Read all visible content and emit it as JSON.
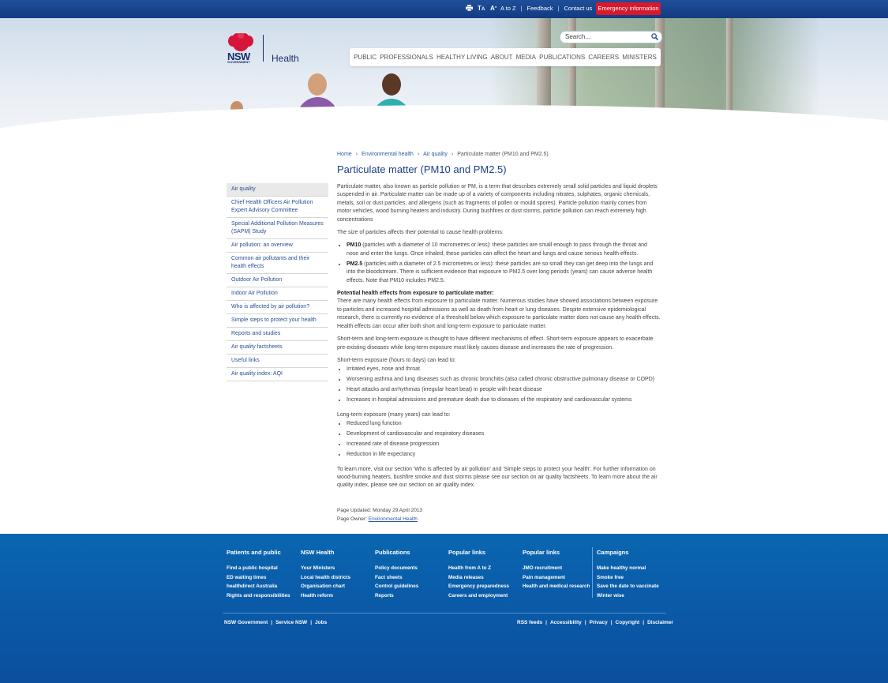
{
  "topbar": {
    "tools": [
      "print-icon",
      "text-size-icon",
      "text-resize-icon"
    ],
    "links": [
      "A to Z",
      "Feedback",
      "Contact us"
    ],
    "emergency": "Emergency information"
  },
  "logo": {
    "nsw": "NSW",
    "government": "GOVERNMENT",
    "health": "Health"
  },
  "search": {
    "placeholder": "Search..."
  },
  "nav": [
    "PUBLIC",
    "PROFESSIONALS",
    "HEALTHY LIVING",
    "ABOUT",
    "MEDIA",
    "PUBLICATIONS",
    "CAREERS",
    "MINISTERS"
  ],
  "breadcrumb": [
    "Home",
    "Environmental health",
    "Air quality",
    "Particulate matter (PM10 and PM2.5)"
  ],
  "page_title": "Particulate matter (PM10 and PM2.5)",
  "sidebar": [
    "Air quality",
    "Chief Health Officers Air Pollution Expert Advisory Committee",
    "Special Additional Pollution Measures (SAPM) Study",
    "Air pollution: an overview",
    "Common air pollutants and their health effects",
    "Outdoor Air Pollution",
    "Indoor Air Pollution",
    "Who is affected by air pollution?",
    "Simple steps to protect your health",
    "Reports and studies",
    "Air quality factsheets",
    "Useful links",
    "Air quality index: AQI"
  ],
  "content": {
    "intro": "Particulate matter, also known as particle pollution or PM, is a term that describes extremely small solid particles and liquid droplets suspended in air. Particulate matter can be made up of a variety of components including nitrates, sulphates, organic chemicals, metals, soil or dust particles, and allergens (such as fragments of pollen or mould spores). Particle pollution mainly comes from motor vehicles, wood burning heaters and industry. During bushfires or dust storms, particle pollution can reach extremely high concentrations",
    "size_intro": "The size of particles affects their potential to cause health problems:",
    "pm10_label": "PM10",
    "pm10_text": " (particles with a diameter of 10 micrometres or less): these particles are small enough to pass through the throat and nose and enter the lungs. Once inhaled, these particles can affect the heart and lungs and cause serious health effects.",
    "pm25_label": "PM2.5",
    "pm25_text": " (particles with a diameter of 2.5 micrometres or less): these particles are so small they can get deep into the lungs and into the bloodstream. There is sufficient evidence that exposure to PM2.5 over long periods (years) can cause adverse health effects. Note that PM10 includes PM2.5.",
    "effects_heading": "Potential health effects from exposure to particulate matter:",
    "effects_text": "There are many health effects from exposure to particulate matter. Numerous studies have showed associations between exposure to particles and increased hospital admissions as well as death from heart or lung diseases. Despite extensive epidemiological research, there is currently no evidence of a threshold below which exposure to particulate matter does not cause any health effects. Health effects can occur after both short and long-term exposure to particulate matter.",
    "mechanisms": "Short-term and long-term exposure is thought to have different mechanisms of effect. Short-term exposure appears to exacerbate pre-existing diseases while long-term exposure most likely causes disease and increases the rate of progression.",
    "short_intro": "Short-term exposure (hours to days) can lead to:",
    "short_list": [
      "Irritated eyes, nose and throat",
      "Worsening asthma and lung diseases such as chronic bronchitis (also called chronic obstructive pulmonary disease or COPD)",
      "Heart attacks and arrhythmias (irregular heart beat) in people with heart disease",
      "Increases in hospital admissions and premature death due to diseases of the respiratory and cardiovascular systems"
    ],
    "long_intro": "Long-term exposure (many years) can lead to:",
    "long_list": [
      "Reduced lung function",
      "Development of cardiovascular and respiratory diseases",
      "Increased rate of disease progression",
      "Reduction in life expectancy"
    ],
    "learn_more": "To learn more, visit our section 'Who is affected by air pollution' and 'Simple steps to protect your health'. For further information on wood-burning heaters, bushfire smoke and dust storms please see our section on air quality factsheets. To learn more about the air quality index, please see our section on air quality index."
  },
  "meta": {
    "updated": "Page Updated: Monday 29 April 2013",
    "owner_label": "Page Owner: ",
    "owner_link": "Environmental Health"
  },
  "footer": {
    "columns": [
      {
        "heading": "Patients and public",
        "links": [
          "Find a public hospital",
          "ED waiting times",
          "healthdirect Australia",
          "Rights and responsibilities"
        ]
      },
      {
        "heading": "NSW Health",
        "links": [
          "Your Ministers",
          "Local health districts",
          "Organisation chart",
          "Health reform"
        ]
      },
      {
        "heading": "Publications",
        "links": [
          "Policy documents",
          "Fact sheets",
          "Control guidelines",
          "Reports"
        ]
      },
      {
        "heading": "Popular links",
        "links": [
          "Health from A to Z",
          "Media releases",
          "Emergency preparedness",
          "Careers and employment"
        ]
      },
      {
        "heading": "Popular links",
        "links": [
          "JMO recruitment",
          "Pain management",
          "Health and medical research"
        ]
      },
      {
        "heading": "Campaigns",
        "links": [
          "Make healthy normal",
          "Smoke free",
          "Save the date to vaccinate",
          "Winter wise"
        ]
      }
    ],
    "bottom_left": [
      "NSW Government",
      "Service NSW",
      "Jobs"
    ],
    "bottom_right": [
      "RSS feeds",
      "Accessibility",
      "Privacy",
      "Copyright",
      "Disclaimer"
    ]
  },
  "colors": {
    "brand_blue": "#1f4e9a",
    "emergency_red": "#d9182b",
    "title_blue": "#1f3f8a",
    "footer_blue": "#0a5ca9"
  }
}
